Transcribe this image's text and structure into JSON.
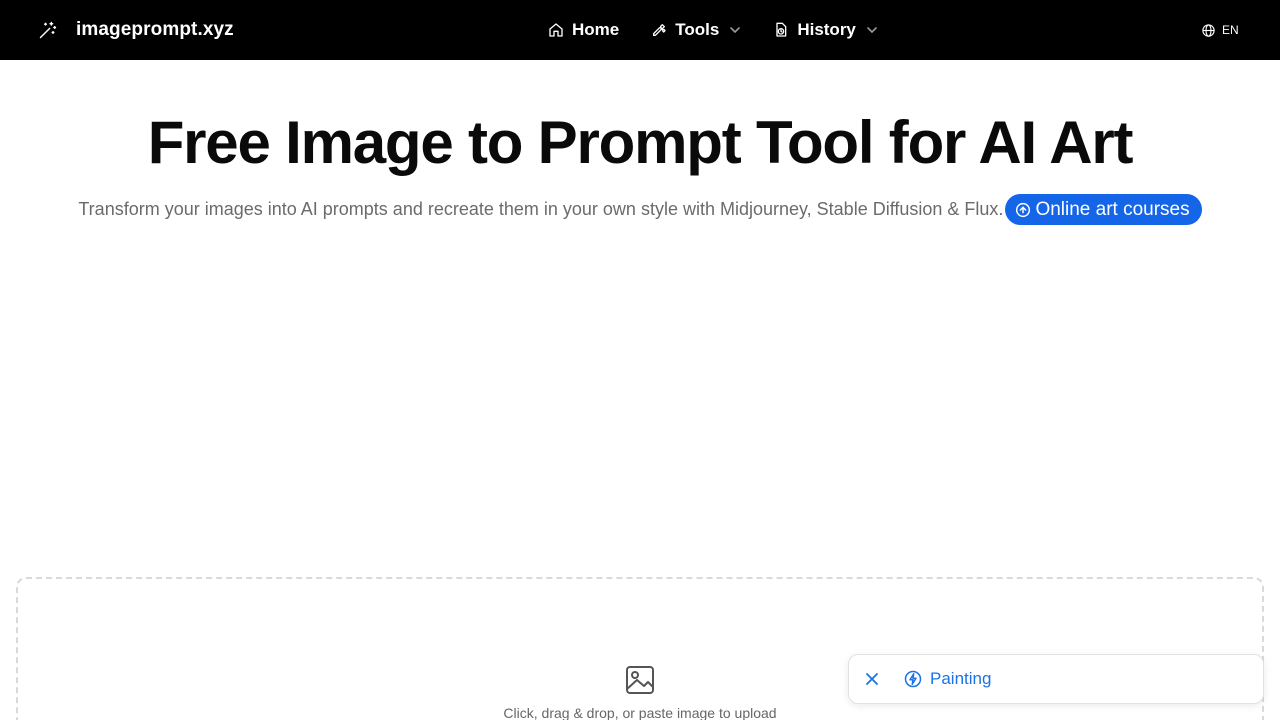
{
  "header": {
    "brand_name": "imageprompt.xyz",
    "nav": [
      {
        "label": "Home",
        "icon": "home-icon",
        "has_dropdown": false
      },
      {
        "label": "Tools",
        "icon": "wrench-icon",
        "has_dropdown": true
      },
      {
        "label": "History",
        "icon": "history-icon",
        "has_dropdown": true
      }
    ],
    "language": "EN"
  },
  "hero": {
    "title": "Free Image to Prompt Tool for AI Art",
    "subtitle": "Transform your images into AI prompts and recreate them in your own style with Midjourney, Stable Diffusion & Flux.",
    "courses_button": "Online art courses"
  },
  "upload": {
    "instruction": "Click, drag & drop, or paste image to upload"
  },
  "toast": {
    "label": "Painting"
  },
  "colors": {
    "header_bg": "#000000",
    "accent": "#1565e8",
    "toast_text": "#1a73e8"
  }
}
